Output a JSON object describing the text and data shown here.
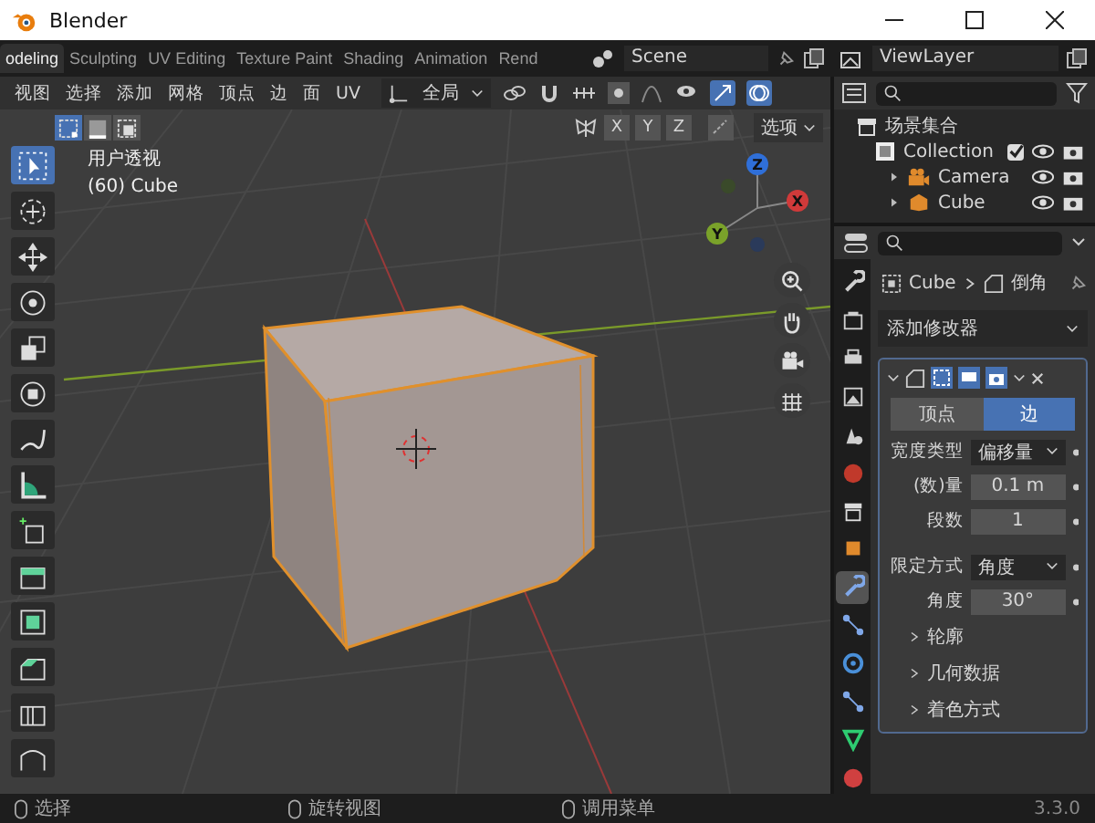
{
  "window": {
    "title": "Blender"
  },
  "workspace_tabs": [
    {
      "label": "odeling",
      "selected": true
    },
    {
      "label": "Sculpting",
      "selected": false
    },
    {
      "label": "UV Editing",
      "selected": false
    },
    {
      "label": "Texture Paint",
      "selected": false
    },
    {
      "label": "Shading",
      "selected": false
    },
    {
      "label": "Animation",
      "selected": false
    },
    {
      "label": "Rend",
      "selected": false
    }
  ],
  "scene": {
    "value": "Scene"
  },
  "view_layer": {
    "value": "ViewLayer"
  },
  "viewport": {
    "menus": [
      "视图",
      "选择",
      "添加",
      "网格",
      "顶点",
      "边",
      "面",
      "UV"
    ],
    "orientation": "全局",
    "select_modes": [
      {
        "kind": "vertex",
        "selected": true
      },
      {
        "kind": "edge",
        "selected": false
      },
      {
        "kind": "face",
        "selected": false
      }
    ],
    "mirror_axes": [
      "X",
      "Y",
      "Z"
    ],
    "options": "选项",
    "overlay_lines": [
      "用户透视",
      "(60) Cube"
    ],
    "gizmo_labels": [
      "Z",
      "Y",
      "X"
    ],
    "tools": [
      {
        "kind": "select",
        "selected": true
      },
      {
        "kind": "cursor",
        "selected": false
      },
      {
        "kind": "move",
        "selected": false
      },
      {
        "kind": "rotate",
        "selected": false
      },
      {
        "kind": "scale",
        "selected": false
      },
      {
        "kind": "transform",
        "selected": false
      },
      {
        "kind": "annotate",
        "selected": false
      },
      {
        "kind": "measure",
        "selected": false
      },
      {
        "kind": "add-cube",
        "selected": false
      },
      {
        "kind": "extrude",
        "selected": false
      },
      {
        "kind": "inset",
        "selected": false
      },
      {
        "kind": "bevel",
        "selected": false
      },
      {
        "kind": "loop-cut",
        "selected": false
      },
      {
        "kind": "knife",
        "selected": false
      }
    ]
  },
  "outliner": {
    "title": "场景集合",
    "items": [
      {
        "label": "Collection",
        "checked": true,
        "children": [
          {
            "label": "Camera",
            "kind": "camera"
          },
          {
            "label": "Cube",
            "kind": "mesh"
          }
        ]
      }
    ]
  },
  "properties": {
    "tabs": [
      {
        "kind": "tool",
        "selected": false
      },
      {
        "kind": "render",
        "selected": false
      },
      {
        "kind": "output",
        "selected": false
      },
      {
        "kind": "view-layer",
        "selected": false
      },
      {
        "kind": "scene",
        "selected": false
      },
      {
        "kind": "world",
        "selected": false
      },
      {
        "kind": "collection",
        "selected": false
      },
      {
        "kind": "object",
        "selected": false
      },
      {
        "kind": "modifier",
        "selected": true
      },
      {
        "kind": "particles",
        "selected": false
      },
      {
        "kind": "physics",
        "selected": false
      },
      {
        "kind": "constraints",
        "selected": false
      },
      {
        "kind": "data",
        "selected": false
      },
      {
        "kind": "material",
        "selected": false
      }
    ],
    "breadcrumb": [
      "Cube",
      "倒角"
    ],
    "add_modifier": "添加修改器",
    "modifier": {
      "affect": [
        {
          "label": "顶点",
          "selected": false
        },
        {
          "label": "边",
          "selected": true
        }
      ],
      "fields": [
        {
          "label": "宽度类型",
          "kind": "dropdown",
          "value": "偏移量"
        },
        {
          "label": "(数)量",
          "kind": "number",
          "value": "0.1 m"
        },
        {
          "label": "段数",
          "kind": "number",
          "value": "1"
        },
        {
          "label": "限定方式",
          "kind": "dropdown",
          "value": "角度"
        },
        {
          "label": "角度",
          "kind": "number",
          "value": "30°"
        }
      ],
      "sections": [
        "轮廓",
        "几何数据",
        "着色方式"
      ]
    }
  },
  "status_bar": {
    "hints": [
      "选择",
      "旋转视图",
      "调用菜单"
    ],
    "version": "3.3.0"
  }
}
